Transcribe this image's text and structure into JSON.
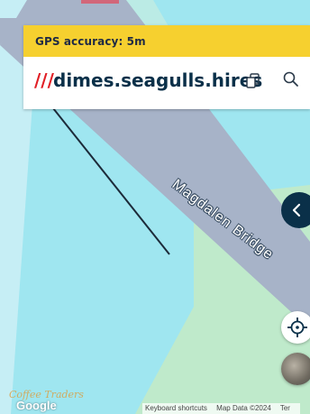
{
  "gps": {
    "accuracy_label": "GPS accuracy: 5m"
  },
  "address": {
    "slashes": "///",
    "words": "dimes.seagulls.hires"
  },
  "icons": {
    "copy": "copy-icon",
    "search": "search-icon",
    "toggle": "chevron-left-icon",
    "locate": "crosshair-icon"
  },
  "map": {
    "bridge_label": "Magdalen Bridge",
    "watermark": "Coffee Traders",
    "logo": "Google",
    "attribution": {
      "shortcuts": "Keyboard shortcuts",
      "data": "Map Data ©2024",
      "terms": "Ter"
    }
  },
  "colors": {
    "gps_bar": "#f6d02f",
    "slashes": "#e11f26",
    "words": "#0a3049",
    "water": "#9fe6f0",
    "park": "#bfeacb",
    "road": "#a7b3c8"
  }
}
